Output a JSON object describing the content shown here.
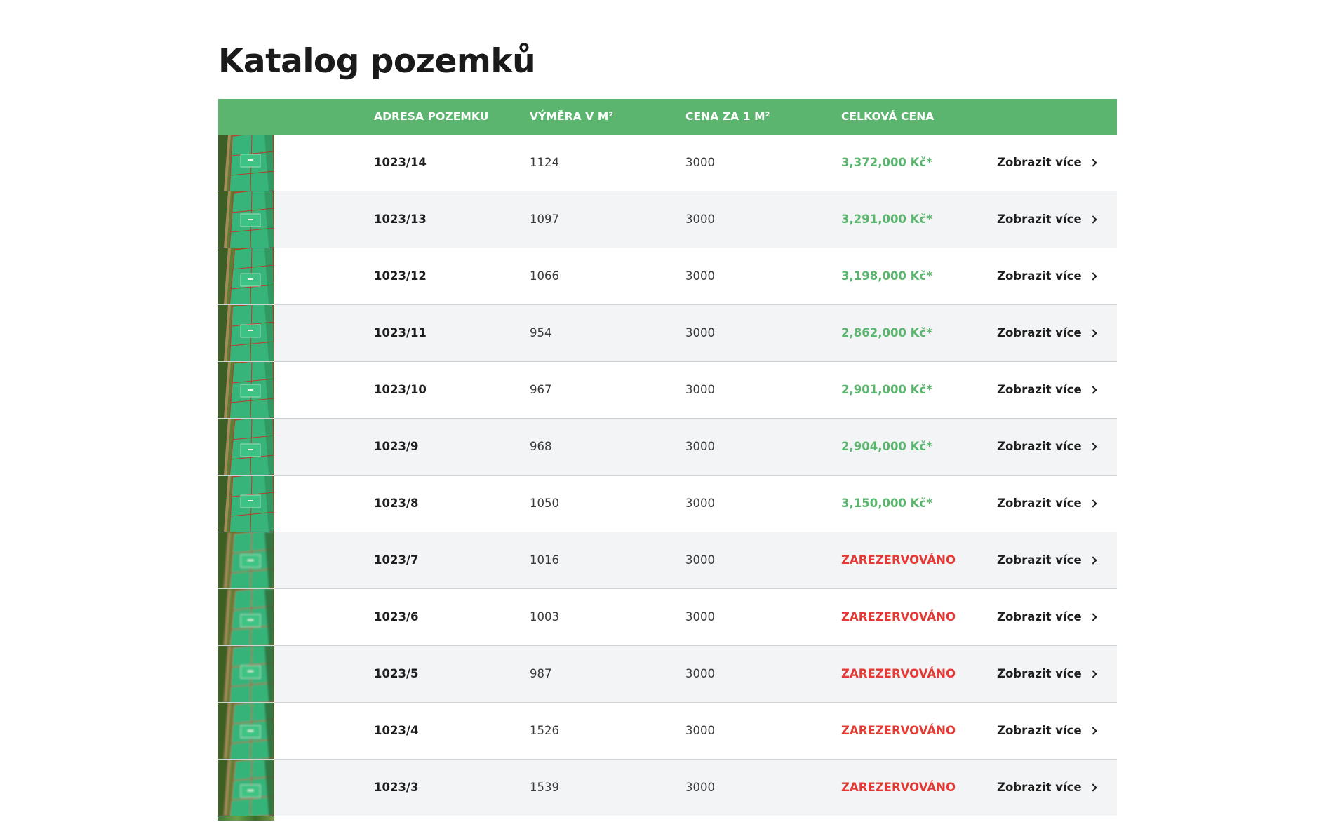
{
  "page": {
    "title": "Katalog pozemků"
  },
  "colors": {
    "accent_green": "#5cb56e",
    "reserved_red": "#e53935",
    "row_alt": "#f3f4f6"
  },
  "table": {
    "columns": [
      "",
      "ADRESA POZEMKU",
      "VÝMĚRA V M²",
      "CENA ZA 1 M²",
      "CELKOVÁ CENA",
      ""
    ],
    "rows": [
      {
        "address": "1023/14",
        "area": "1124",
        "unit_price": "3000",
        "total": "3,372,000 Kč*",
        "status": "available",
        "action": "Zobrazit více"
      },
      {
        "address": "1023/13",
        "area": "1097",
        "unit_price": "3000",
        "total": "3,291,000 Kč*",
        "status": "available",
        "action": "Zobrazit více"
      },
      {
        "address": "1023/12",
        "area": "1066",
        "unit_price": "3000",
        "total": "3,198,000 Kč*",
        "status": "available",
        "action": "Zobrazit více"
      },
      {
        "address": "1023/11",
        "area": "954",
        "unit_price": "3000",
        "total": "2,862,000 Kč*",
        "status": "available",
        "action": "Zobrazit více"
      },
      {
        "address": "1023/10",
        "area": "967",
        "unit_price": "3000",
        "total": "2,901,000 Kč*",
        "status": "available",
        "action": "Zobrazit více"
      },
      {
        "address": "1023/9",
        "area": "968",
        "unit_price": "3000",
        "total": "2,904,000 Kč*",
        "status": "available",
        "action": "Zobrazit více"
      },
      {
        "address": "1023/8",
        "area": "1050",
        "unit_price": "3000",
        "total": "3,150,000 Kč*",
        "status": "available",
        "action": "Zobrazit více"
      },
      {
        "address": "1023/7",
        "area": "1016",
        "unit_price": "3000",
        "total": "ZAREZERVOVÁNO",
        "status": "reserved",
        "action": "Zobrazit více"
      },
      {
        "address": "1023/6",
        "area": "1003",
        "unit_price": "3000",
        "total": "ZAREZERVOVÁNO",
        "status": "reserved",
        "action": "Zobrazit více"
      },
      {
        "address": "1023/5",
        "area": "987",
        "unit_price": "3000",
        "total": "ZAREZERVOVÁNO",
        "status": "reserved",
        "action": "Zobrazit více"
      },
      {
        "address": "1023/4",
        "area": "1526",
        "unit_price": "3000",
        "total": "ZAREZERVOVÁNO",
        "status": "reserved",
        "action": "Zobrazit více"
      },
      {
        "address": "1023/3",
        "area": "1539",
        "unit_price": "3000",
        "total": "ZAREZERVOVÁNO",
        "status": "reserved",
        "action": "Zobrazit více"
      }
    ]
  }
}
